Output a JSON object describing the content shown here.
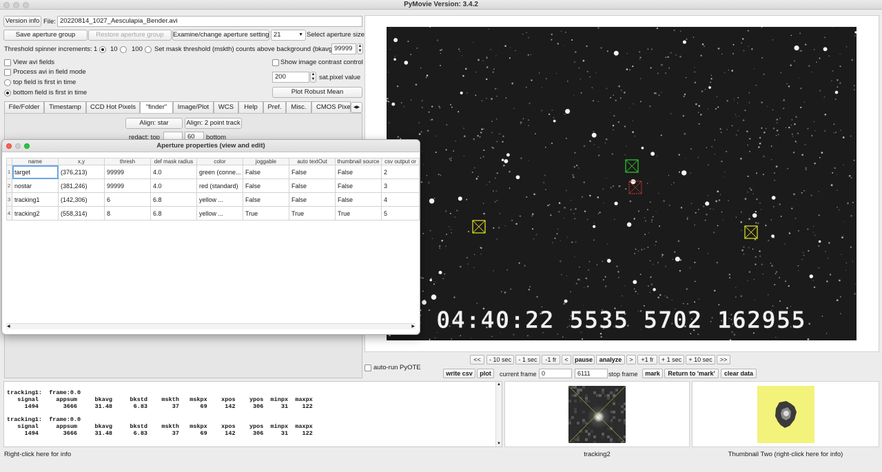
{
  "window": {
    "title": "PyMovie  Version: 3.4.2"
  },
  "top": {
    "version_info": "Version info",
    "file_label": "File:",
    "file_value": "20220814_1027_Aesculapia_Bender.avi",
    "save_aperture_group": "Save aperture group",
    "restore_aperture_group": "Restore aperture group",
    "examine_aperture_settings": "Examine/change aperture settings",
    "aperture_size_value": "21",
    "select_aperture_size": "Select aperture size",
    "threshold_label": "Threshold spinner increments:",
    "threshold_options": [
      "1",
      "10",
      "100"
    ],
    "mask_threshold_label": "Set mask threshold (mskth) counts above background (bkavg)",
    "mask_threshold_value": "99999",
    "view_avi_fields": "View avi fields",
    "process_field_mode": "Process avi in field mode",
    "top_field_first": "top field is first in time",
    "bottom_field_first": "bottom field is first in time",
    "show_contrast": "Show image contrast control",
    "sat_value": "200",
    "sat_label": "sat.pixel value",
    "plot_robust_mean": "Plot Robust Mean"
  },
  "tabs": [
    "File/Folder",
    "Timestamp",
    "CCD Hot Pixels",
    "\"finder\"",
    "Image/Plot",
    "WCS",
    "Help",
    "Pref.",
    "Misc.",
    "CMOS Pixe"
  ],
  "finder": {
    "align_star": "Align: star",
    "align_two_point": "Align: 2 point track",
    "redact_top_label": "redact: top",
    "redact_bottom_value": "60",
    "redact_bottom_label": "bottom"
  },
  "aperture_window": {
    "title": "Aperture properties (view and edit)",
    "columns": [
      "name",
      "x,y",
      "thresh",
      "def mask radius",
      "color",
      "joggable",
      "auto textOut",
      "thumbnail source",
      "csv output or"
    ],
    "rows": [
      {
        "n": "1",
        "cells": [
          "target",
          "(376,213)",
          "99999",
          "4.0",
          "green (conne...",
          "False",
          "False",
          "False",
          "2"
        ]
      },
      {
        "n": "2",
        "cells": [
          "nostar",
          "(381,246)",
          "99999",
          "4.0",
          "red (standard)",
          "False",
          "False",
          "False",
          "3"
        ]
      },
      {
        "n": "3",
        "cells": [
          "tracking1",
          "(142,306)",
          "6",
          "6.8",
          "yellow ...",
          "False",
          "False",
          "False",
          "4"
        ]
      },
      {
        "n": "4",
        "cells": [
          "tracking2",
          "(558,314)",
          "8",
          "6.8",
          "yellow ...",
          "True",
          "True",
          "True",
          "5"
        ]
      }
    ]
  },
  "video": {
    "timestamp": "04:40:22 5535 5702 162955",
    "aperture_colors": {
      "target": "#2ecc2e",
      "nostar": "#e53c2e",
      "tracking": "#e8e81e"
    }
  },
  "controls": {
    "nav": [
      "<<",
      "- 10 sec",
      "- 1 sec",
      "-1 fr",
      "<",
      "pause",
      "analyze",
      ">",
      "+1 fr",
      "+ 1 sec",
      "+ 10 sec",
      ">>"
    ],
    "auto_run": "auto-run PyOTE",
    "write_csv": "write csv",
    "plot": "plot",
    "current_frame_label": "current frame",
    "current_frame_value": "0",
    "stop_frame_value": "6111",
    "stop_frame_label": "stop frame",
    "mark": "mark",
    "return_mark": "Return to 'mark'",
    "clear_data": "clear data"
  },
  "text_output": "tracking1:  frame:0.0\n   signal     appsum     bkavg     bkstd    mskth   mskpx    xpos    ypos  minpx  maxpx\n     1494       3666     31.48      6.83       37      69     142     306     31    122\n\ntracking1:  frame:0.0\n   signal     appsum     bkavg     bkstd    mskth   mskpx    xpos    ypos  minpx  maxpx\n     1494       3666     31.48      6.83       37      69     142     306     31    122",
  "footer": {
    "right_click_info": "Right-click here for info",
    "thumb_one_label": "tracking2",
    "thumb_two_label": "Thumbnail Two (right-click here for info)"
  }
}
